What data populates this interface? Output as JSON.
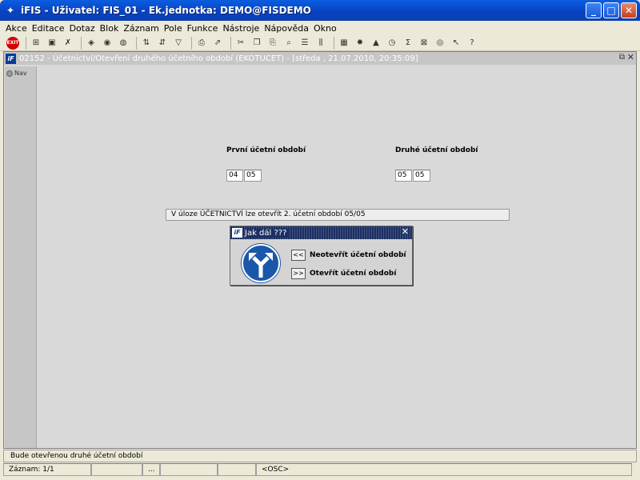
{
  "window": {
    "title": "iFIS - Uživatel: FIS_01 - Ek.jednotka: DEMO@FISDEMO",
    "minimize": "_",
    "maximize": "□",
    "close": "✕"
  },
  "menu": [
    "Akce",
    "Editace",
    "Dotaz",
    "Blok",
    "Záznam",
    "Pole",
    "Funkce",
    "Nástroje",
    "Nápověda",
    "Okno"
  ],
  "toolbar": {
    "exit_label": "EXIT"
  },
  "form": {
    "title": "02152 - Účetnictví/Otevření druhého účetního období (EKOTUCET) - [středa , 21.07.2010, 20:35:09]",
    "nav_label": "Nav",
    "first_period_label": "První účetní období",
    "first_period_month": "04",
    "first_period_year": "05",
    "second_period_label": "Druhé účetní období",
    "second_period_month": "05",
    "second_period_year": "05",
    "message": "V úloze ÚČETNICTVÍ lze otevřít 2. účetní období 05/05"
  },
  "dialog": {
    "title": "Jak dál ???",
    "close": "✕",
    "option_back_button": "<<",
    "option_back_label": "Neotevřít účetní období",
    "option_forward_button": ">>",
    "option_forward_label": "Otevřít účetní období"
  },
  "status": {
    "message": "Bude otevřenou druhé účetní období",
    "record": "Záznam: 1/1",
    "cell3": "...",
    "mode": "<OSC>"
  }
}
